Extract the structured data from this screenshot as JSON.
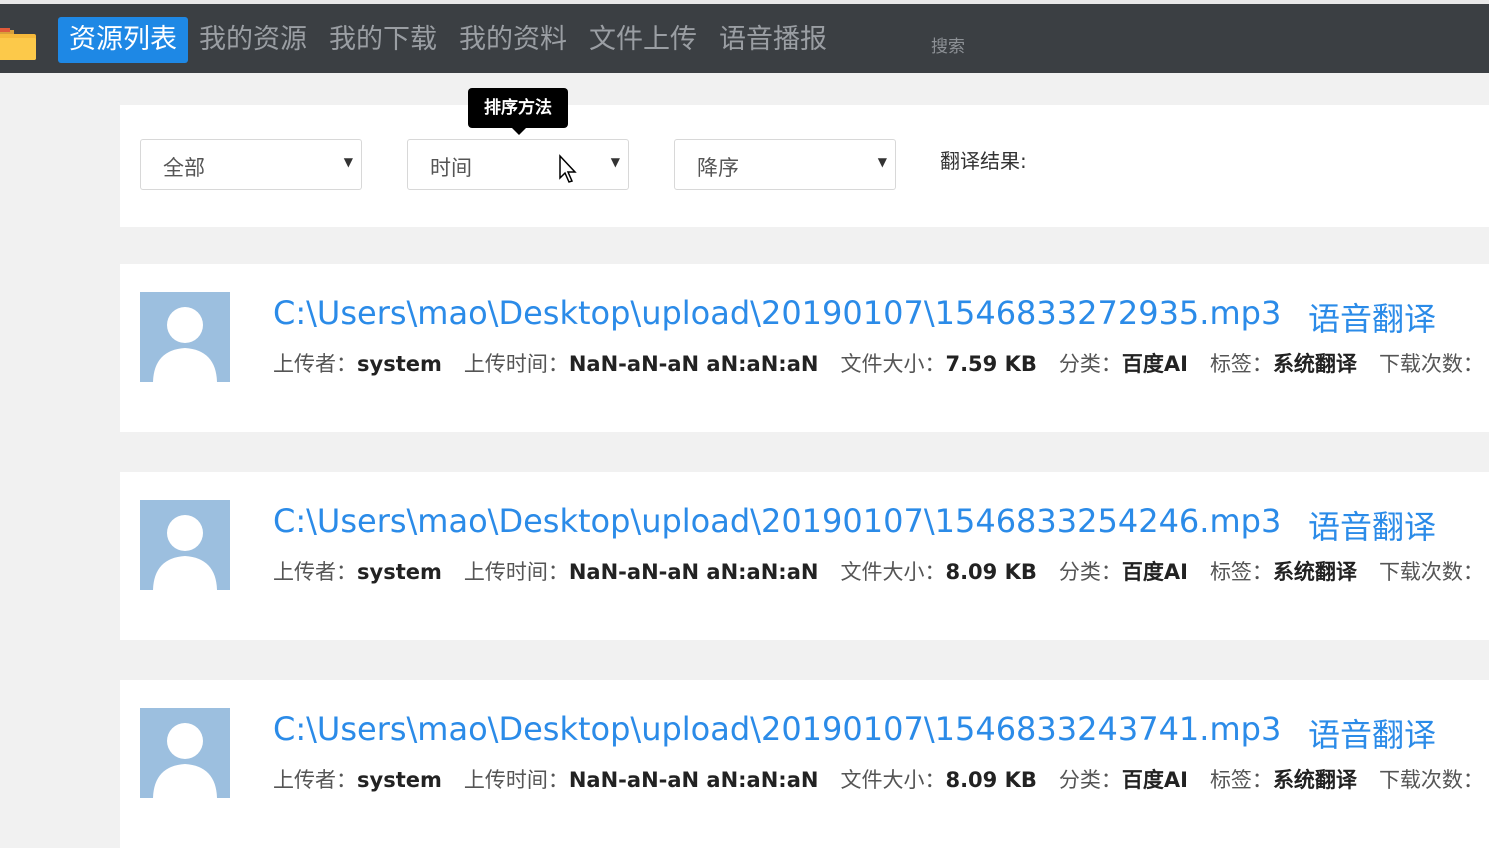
{
  "nav": {
    "items": [
      {
        "label": "资源列表",
        "active": true
      },
      {
        "label": "我的资源",
        "active": false
      },
      {
        "label": "我的下载",
        "active": false
      },
      {
        "label": "我的资料",
        "active": false
      },
      {
        "label": "文件上传",
        "active": false
      },
      {
        "label": "语音播报",
        "active": false
      }
    ],
    "search_label": "搜索",
    "logo_icon": "folder-icon"
  },
  "filters": {
    "category": {
      "value": "全部"
    },
    "sort_field": {
      "value": "时间"
    },
    "sort_order": {
      "value": "降序"
    },
    "tooltip": "排序方法",
    "translate_label": "翻译结果:"
  },
  "colors": {
    "navbar_bg": "#3b3f43",
    "active_nav": "#1e88e5",
    "link": "#2b8be8",
    "avatar_bg": "#9cbfdf"
  },
  "resources": [
    {
      "title": "C:\\Users\\mao\\Desktop\\upload\\20190107\\1546833272935.mp3",
      "action": "语音翻译",
      "uploader_label": "上传者：",
      "uploader": "system",
      "time_label": "上传时间：",
      "time": "NaN-aN-aN aN:aN:aN",
      "size_label": "文件大小：",
      "size": "7.59 KB",
      "category_label": "分类：",
      "category": "百度AI",
      "tag_label": "标签：",
      "tag": "系统翻译",
      "downloads_label": "下载次数："
    },
    {
      "title": "C:\\Users\\mao\\Desktop\\upload\\20190107\\1546833254246.mp3",
      "action": "语音翻译",
      "uploader_label": "上传者：",
      "uploader": "system",
      "time_label": "上传时间：",
      "time": "NaN-aN-aN aN:aN:aN",
      "size_label": "文件大小：",
      "size": "8.09 KB",
      "category_label": "分类：",
      "category": "百度AI",
      "tag_label": "标签：",
      "tag": "系统翻译",
      "downloads_label": "下载次数："
    },
    {
      "title": "C:\\Users\\mao\\Desktop\\upload\\20190107\\1546833243741.mp3",
      "action": "语音翻译",
      "uploader_label": "上传者：",
      "uploader": "system",
      "time_label": "上传时间：",
      "time": "NaN-aN-aN aN:aN:aN",
      "size_label": "文件大小：",
      "size": "8.09 KB",
      "category_label": "分类：",
      "category": "百度AI",
      "tag_label": "标签：",
      "tag": "系统翻译",
      "downloads_label": "下载次数："
    }
  ]
}
